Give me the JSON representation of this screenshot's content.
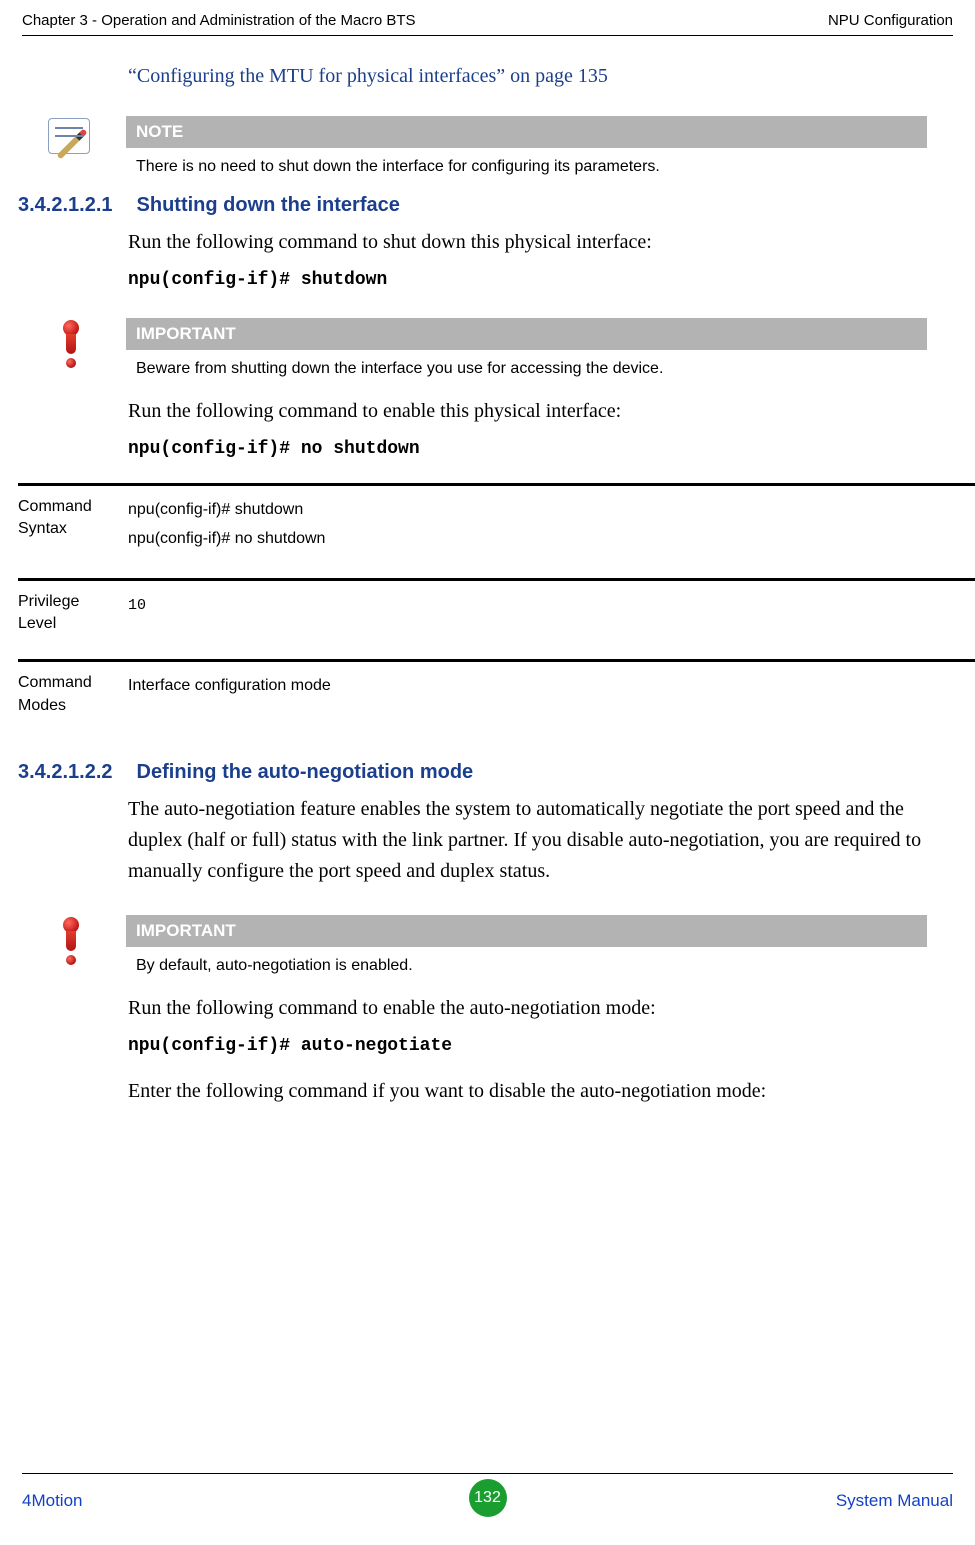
{
  "header": {
    "left": "Chapter 3 - Operation and Administration of the Macro BTS",
    "right": "NPU Configuration"
  },
  "intro_xref": "“Configuring the MTU for physical interfaces” on page 135",
  "note1": {
    "title": "NOTE",
    "text": "There is no need to shut down the interface for configuring its parameters."
  },
  "sec1": {
    "num": "3.4.2.1.2.1",
    "title": "Shutting down the interface",
    "p1": "Run the following command to shut down this physical interface:",
    "cmd1": "npu(config-if)# shutdown",
    "imp_title": "IMPORTANT",
    "imp_text": "Beware from shutting down the interface you use for accessing the device.",
    "p2": "Run the following command to enable this physical interface:",
    "cmd2": "npu(config-if)# no shutdown",
    "tbl": {
      "r1_label": "Command Syntax",
      "r1_v1": "npu(config-if)# shutdown",
      "r1_v2": "npu(config-if)# no shutdown",
      "r2_label": "Privilege Level",
      "r2_v": "10",
      "r3_label": "Command Modes",
      "r3_v": "Interface configuration mode"
    }
  },
  "sec2": {
    "num": "3.4.2.1.2.2",
    "title": "Defining the auto-negotiation mode",
    "p1": "The auto-negotiation feature enables the system to automatically negotiate the port speed and the duplex (half or full) status with the link partner. If you disable auto-negotiation, you are required to manually configure the port speed and duplex status.",
    "imp_title": "IMPORTANT",
    "imp_text": "By default, auto-negotiation is enabled.",
    "p2": "Run the following command to enable the auto-negotiation mode:",
    "cmd1": "npu(config-if)# auto-negotiate",
    "p3": "Enter the following command if you want to disable the auto-negotiation mode:"
  },
  "footer": {
    "left": "4Motion",
    "page": "132",
    "right": "System Manual"
  }
}
